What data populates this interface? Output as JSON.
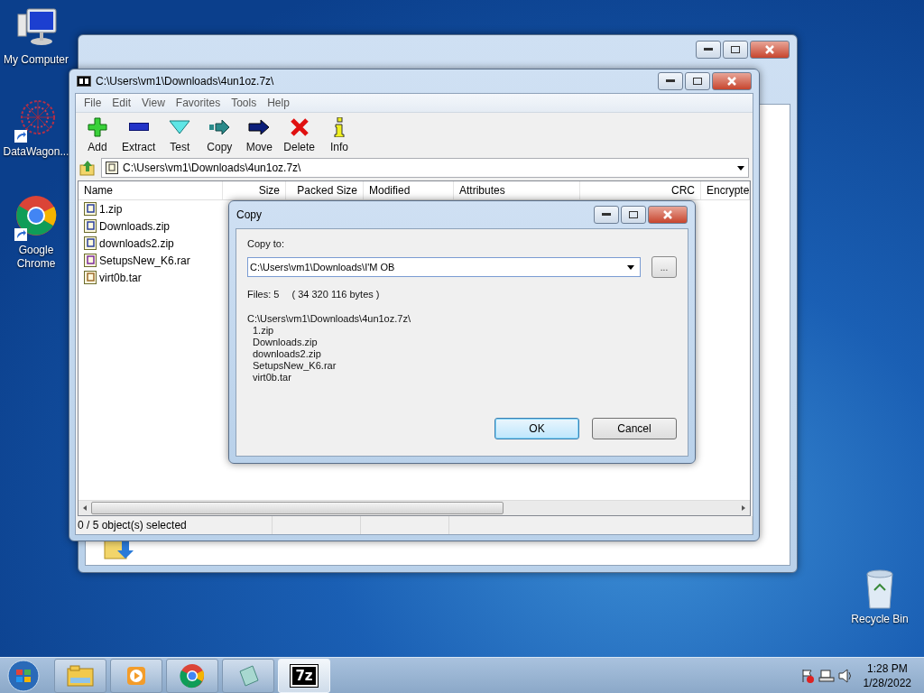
{
  "desktop_icons": [
    {
      "label": "My Computer",
      "kind": "computer",
      "shortcut": false
    },
    {
      "label": "DataWagon...",
      "kind": "star",
      "shortcut": true
    },
    {
      "label": "Google Chrome",
      "kind": "browser",
      "shortcut": true
    }
  ],
  "recycle_bin": {
    "label": "Recycle Bin"
  },
  "archive_window": {
    "title": "C:\\Users\\vm1\\Downloads\\4un1oz.7z\\",
    "menu": [
      "File",
      "Edit",
      "View",
      "Favorites",
      "Tools",
      "Help"
    ],
    "toolbar": [
      {
        "label": "Add",
        "kind": "add"
      },
      {
        "label": "Extract",
        "kind": "extract"
      },
      {
        "label": "Test",
        "kind": "test"
      },
      {
        "label": "Copy",
        "kind": "copy"
      },
      {
        "label": "Move",
        "kind": "move"
      },
      {
        "label": "Delete",
        "kind": "delete"
      },
      {
        "label": "Info",
        "kind": "info"
      }
    ],
    "path": "C:\\Users\\vm1\\Downloads\\4un1oz.7z\\",
    "columns": [
      "Name",
      "Size",
      "Packed Size",
      "Modified",
      "Attributes",
      "CRC",
      "Encrypte"
    ],
    "files": [
      {
        "name": "1.zip",
        "kind": "zip"
      },
      {
        "name": "Downloads.zip",
        "kind": "zip"
      },
      {
        "name": "downloads2.zip",
        "kind": "zip"
      },
      {
        "name": "SetupsNew_K6.rar",
        "kind": "rar"
      },
      {
        "name": "virt0b.tar",
        "kind": "tar"
      }
    ],
    "status_bar": "0 / 5 object(s) selected"
  },
  "copy_dialog": {
    "title": "Copy",
    "label": "Copy to:",
    "value": "C:\\Users\\vm1\\Downloads\\I'M OB",
    "browse": "...",
    "files_count": "Files: 5",
    "bytes": "( 34 320 116 bytes )",
    "source": "C:\\Users\\vm1\\Downloads\\4un1oz.7z\\",
    "items": [
      "1.zip",
      "Downloads.zip",
      "downloads2.zip",
      "SetupsNew_K6.rar",
      "virt0b.tar"
    ],
    "buttons": [
      {
        "label": "OK",
        "default": true
      },
      {
        "label": "Cancel",
        "default": false
      }
    ]
  },
  "taskbar": {
    "items": [
      {
        "kind": "explorer",
        "selected": false
      },
      {
        "kind": "media",
        "selected": false
      },
      {
        "kind": "browser",
        "selected": false
      },
      {
        "kind": "notepad",
        "selected": false
      },
      {
        "kind": "archiver",
        "label": "7z",
        "selected": true
      }
    ],
    "time": "1:28 PM",
    "date": "1/28/2022"
  }
}
